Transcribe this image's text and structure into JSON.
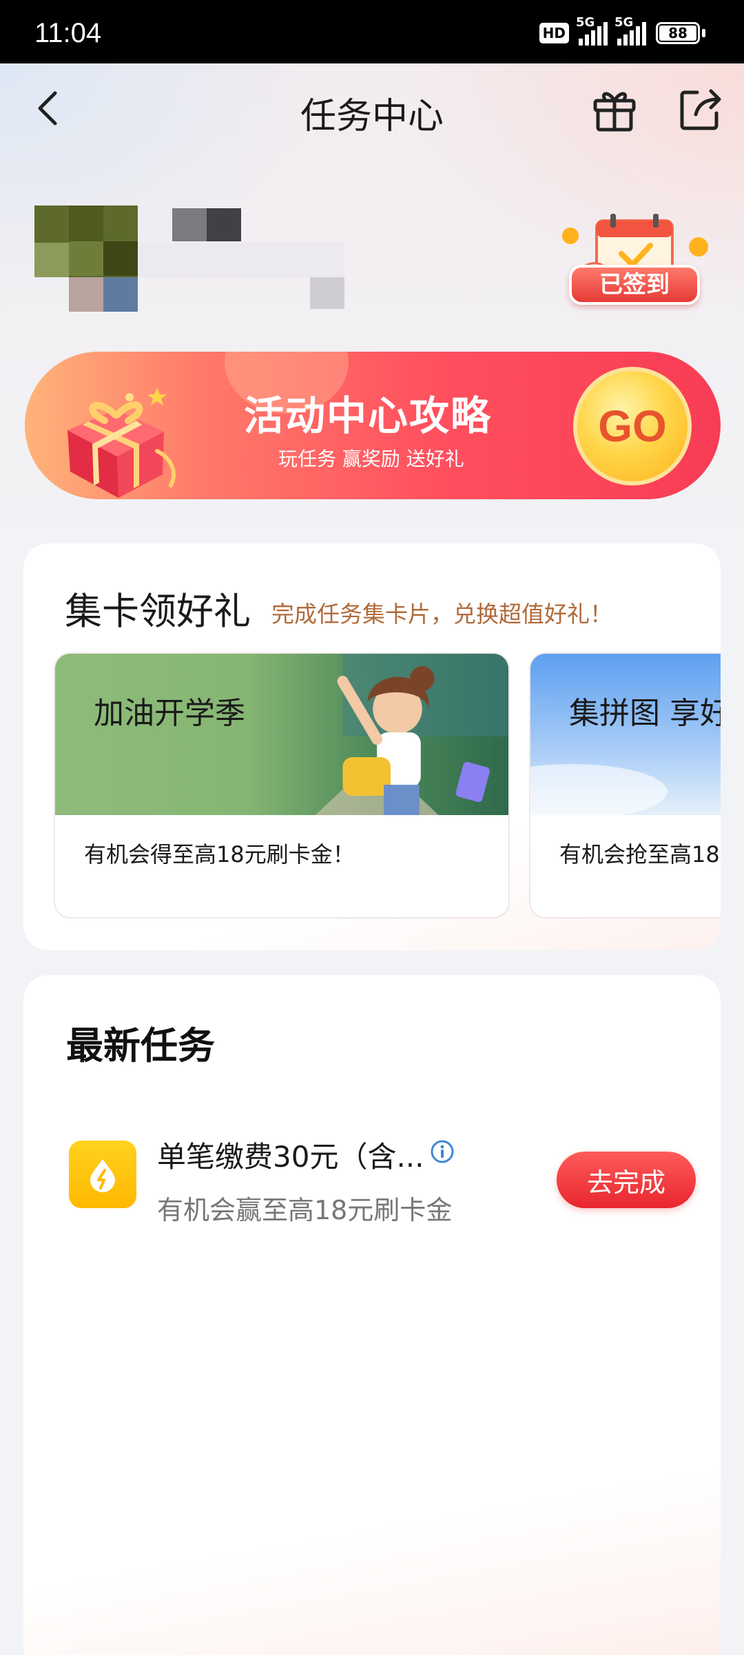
{
  "status_bar": {
    "time": "11:04",
    "hd_label": "HD",
    "signal1_label": "5G",
    "signal2_label": "5G",
    "battery": "88"
  },
  "nav": {
    "title": "任务中心",
    "icons": {
      "back": "back-arrow-icon",
      "gift": "gift-icon",
      "share": "share-icon"
    }
  },
  "user": {
    "signed_label": "已签到"
  },
  "banner": {
    "title": "活动中心攻略",
    "subtitle": "玩任务 赢奖励 送好礼",
    "go_label": "GO"
  },
  "card_section": {
    "title": "集卡领好礼",
    "subtitle": "完成任务集卡片，兑换超值好礼！",
    "cards": [
      {
        "title": "加油开学季",
        "desc": "有机会得至高18元刷卡金！"
      },
      {
        "title": "集拼图 享好",
        "desc": "有机会抢至高18"
      }
    ]
  },
  "tasks": {
    "heading": "最新任务",
    "items": [
      {
        "name": "单笔缴费30元（含...",
        "desc": "有机会赢至高18元刷卡金",
        "button": "去完成"
      }
    ]
  },
  "colors": {
    "accent_red": "#e8262f",
    "banner_gradient_start": "#ffb37a",
    "banner_gradient_end": "#f83c55",
    "subtitle_brown": "#b06a3a",
    "task_icon_yellow": "#ffc107"
  }
}
